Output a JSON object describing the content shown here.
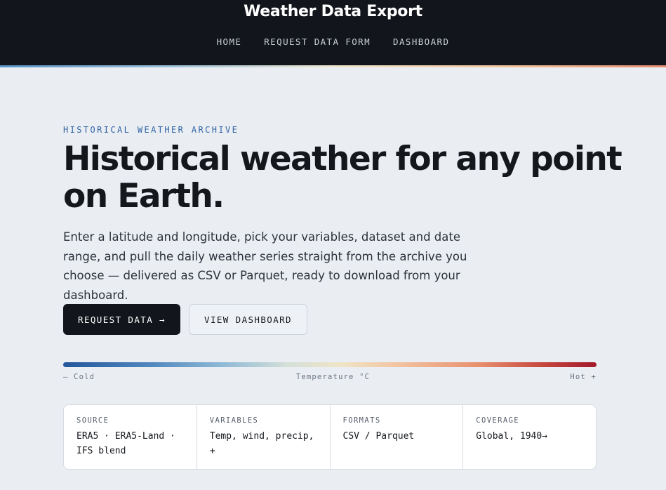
{
  "header": {
    "brand": "Weather Data Export",
    "nav": [
      {
        "label": "HOME"
      },
      {
        "label": "REQUEST DATA FORM"
      },
      {
        "label": "DASHBOARD"
      }
    ]
  },
  "hero": {
    "eyebrow": "HISTORICAL WEATHER ARCHIVE",
    "title_line1": "Historical weather for any point",
    "title_line2": "on Earth.",
    "lede": "Enter a latitude and longitude, pick your variables, dataset and date range, and pull the daily weather series straight from the archive you choose — delivered as CSV or Parquet, ready to download from your dashboard.",
    "primary_button": "REQUEST DATA →",
    "secondary_button": "VIEW DASHBOARD"
  },
  "scale": {
    "left": "– Cold",
    "center": "Temperature °C",
    "right": "Hot +",
    "colors": [
      "#23579b",
      "#8fbad6",
      "#efe5c6",
      "#e8906e",
      "#a3192c"
    ]
  },
  "cards": [
    {
      "label": "SOURCE",
      "value": "ERA5 · ERA5-Land · IFS blend"
    },
    {
      "label": "VARIABLES",
      "value": "Temp, wind, precip, +"
    },
    {
      "label": "FORMATS",
      "value": "CSV / Parquet"
    },
    {
      "label": "COVERAGE",
      "value": "Global, 1940→"
    }
  ],
  "colors": {
    "header_bg": "#12161c",
    "page_bg": "#eaeef3",
    "accent_blue": "#2f63a4"
  }
}
